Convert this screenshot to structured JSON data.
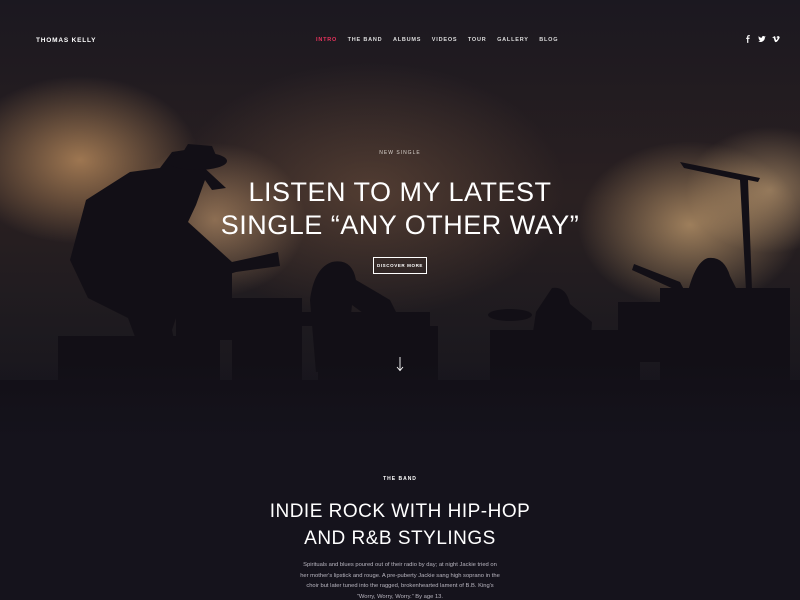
{
  "header": {
    "brand": "THOMAS KELLY",
    "nav": [
      {
        "label": "INTRO",
        "active": true
      },
      {
        "label": "THE BAND",
        "active": false
      },
      {
        "label": "ALBUMS",
        "active": false
      },
      {
        "label": "VIDEOS",
        "active": false
      },
      {
        "label": "TOUR",
        "active": false
      },
      {
        "label": "GALLERY",
        "active": false
      },
      {
        "label": "BLOG",
        "active": false
      }
    ],
    "socials": [
      "facebook-icon",
      "twitter-icon",
      "vimeo-icon"
    ]
  },
  "hero": {
    "eyebrow": "NEW SINGLE",
    "headline_line1": "LISTEN TO MY LATEST",
    "headline_line2": "SINGLE “ANY OTHER WAY”",
    "cta_label": "DISCOVER MORE"
  },
  "band": {
    "eyebrow": "THE BAND",
    "title_line1": "INDIE ROCK WITH HIP-HOP",
    "title_line2": "AND R&B STYLINGS",
    "body": "Spirituals and blues poured out of their radio by day; at night Jackie tried on her mother's lipstick and rouge. A pre-puberty Jackie sang high soprano in the choir but later tuned into the ragged, brokenhearted lament of B.B. King's “Worry, Worry, Worry.” By age 13."
  },
  "colors": {
    "accent": "#e8335d",
    "background": "#15131c",
    "body_text": "#b9b6c0"
  }
}
